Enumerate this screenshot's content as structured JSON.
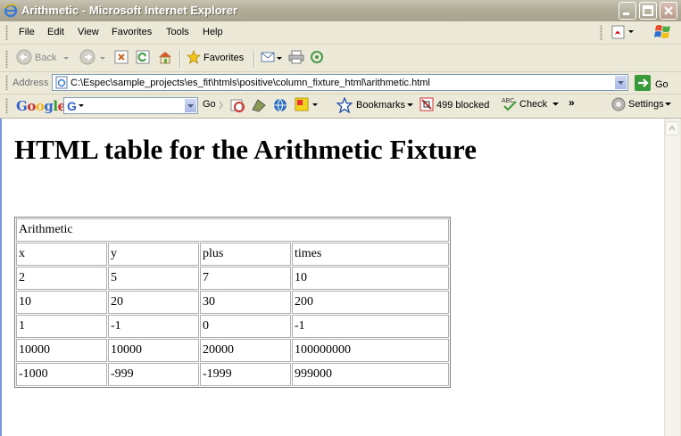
{
  "window": {
    "title": "Arithmetic - Microsoft Internet Explorer",
    "controls": [
      "minimize",
      "maximize",
      "close"
    ]
  },
  "menu": {
    "items": [
      "File",
      "Edit",
      "View",
      "Favorites",
      "Tools",
      "Help"
    ]
  },
  "toolbar": {
    "back_label": "Back",
    "favorites_label": "Favorites"
  },
  "address_bar": {
    "label": "Address",
    "url": "C:\\Espec\\sample_projects\\es_fit\\htmls\\positive\\column_fixture_html\\arithmetic.html",
    "go_label": "Go"
  },
  "google_toolbar": {
    "logo": "Google",
    "go_label": "Go",
    "bookmarks_label": "Bookmarks",
    "blocked_label": "499 blocked",
    "check_label": "Check",
    "settings_label": "Settings"
  },
  "page": {
    "heading": "HTML table for the Arithmetic Fixture",
    "table": {
      "title": "Arithmetic",
      "headers": [
        "x",
        "y",
        "plus",
        "times"
      ],
      "rows": [
        [
          "2",
          "5",
          "7",
          "10"
        ],
        [
          "10",
          "20",
          "30",
          "200"
        ],
        [
          "1",
          "-1",
          "0",
          "-1"
        ],
        [
          "10000",
          "10000",
          "20000",
          "100000000"
        ],
        [
          "-1000",
          "-999",
          "-1999",
          "999000"
        ]
      ]
    }
  }
}
